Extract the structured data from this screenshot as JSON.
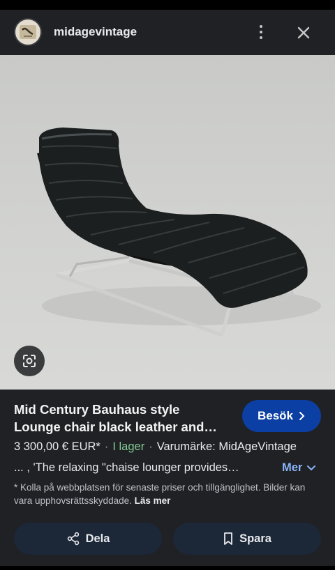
{
  "header": {
    "site_name": "midagevintage",
    "avatar_icon": "chair-logo-icon",
    "menu_icon": "more-vert-icon",
    "close_icon": "close-icon"
  },
  "image": {
    "alt": "Black leather chaise lounge on chrome frame",
    "lens_icon": "google-lens-icon"
  },
  "product": {
    "title_line1": "Mid Century Bauhaus style",
    "title_line2": "Lounge chair black leather and…",
    "visit_label": "Besök",
    "price": "3 300,00 € EUR*",
    "stock": "I lager",
    "brand": "Varumärke: MidAgeVintage",
    "description": "... , 'The relaxing \"chaise lounger provides…",
    "more_label": "Mer"
  },
  "disclaimer": {
    "text": "* Kolla på webbplatsen för senaste priser och tillgänglighet. Bilder kan vara upphovsrättsskyddade.",
    "read_more": "Läs mer"
  },
  "actions": {
    "share_label": "Dela",
    "save_label": "Spara"
  },
  "colors": {
    "background": "#202124",
    "visit_button": "#0b3fa3",
    "stock_green": "#81c995",
    "link_blue": "#8ab4f8",
    "action_button": "#1c2738"
  }
}
